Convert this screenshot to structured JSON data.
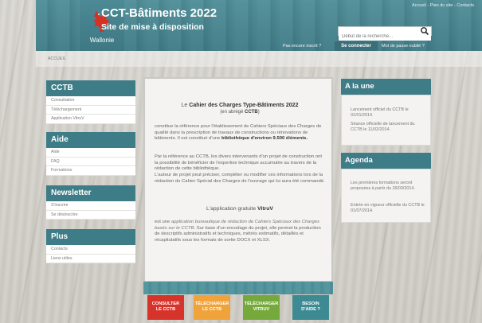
{
  "header": {
    "logo_text": "Wallonie",
    "title": "CCT-Bâtiments 2022",
    "subtitle": "Site de mise à disposition",
    "top_links": "Accueil - Plan du site - Contacts",
    "search_placeholder": "Début de la recherche...",
    "signup_text": "Pas encore inscrit ?",
    "login_label": "Se connecter",
    "forgot_label": "Mot de passe oublié ?"
  },
  "breadcrumb": "ACCUEIL",
  "left_sidebar": {
    "cctb": {
      "title": "CCTB",
      "items": [
        "Consultation",
        "Téléchargement",
        "Application VitruV"
      ]
    },
    "aide": {
      "title": "Aide",
      "items": [
        "Aide",
        "FAQ",
        "Formations"
      ]
    },
    "newsletter": {
      "title": "Newsletter",
      "items": [
        "S'inscrire",
        "Se désinscrire"
      ]
    },
    "plus": {
      "title": "Plus",
      "items": [
        "Contacts",
        "Liens utiles"
      ]
    }
  },
  "content": {
    "title_prefix": "Le ",
    "title_bold": "Cahier des Charges Type-Bâtiments 2022",
    "subtitle_prefix": "(en abrégé ",
    "subtitle_bold": "CCTB",
    "subtitle_suffix": ")",
    "para1_text": "constitue la référence pour l'établissement de Cahiers Spéciaux des Charges de qualité dans la prescription de travaux de constructions ou rénovations de bâtiments.  Il est constitué d'une ",
    "para1_bold": "bibliothèque d'environ 9.500 éléments.",
    "para2": "Par la référence au CCTB, les divers intervenants d'un projet de construction ont la possibilité de bénéficier de l'expertise technique accumulée au travers de la rédaction de cette bibliothèque.",
    "para3": "L'auteur de projet peut préciser, compléter ou modifier ces informations lors de la rédaction du Cahier Spécial des Charges de l'ouvrage qui lui aura été commandé.",
    "app_prefix": "L'application gratuite ",
    "app_bold": "VitruV",
    "para4_prefix": "est une ",
    "para4_italic": "application bureautique de rédaction de Cahiers Spéciaux des Charges basés sur le CCTB",
    "para4_suffix": ".  Sur base d'un encodage du projet, elle permet la production de descriptifs administratifs et techniques, métrés estimatifs, détaillés et récapitulatifs sous les formats de sortie DOCX et XLSX."
  },
  "actions": [
    {
      "line1": "CONSULTER",
      "line2": "LE CCTB",
      "color": "#d6332b"
    },
    {
      "line1": "TÉLÉCHARGER",
      "line2": "LE CCTB",
      "color": "#f0a23b"
    },
    {
      "line1": "TÉLÉCHARGER",
      "line2": "VITRUV",
      "color": "#76a93c"
    },
    {
      "line1": "BESOIN",
      "line2": "D'AIDE ?",
      "color": "#3d8a93"
    }
  ],
  "right_sidebar": {
    "une": {
      "title": "A la une",
      "items": [
        "Lancement officiel du CCTB le 01/01/2014.",
        "Séance officielle de lancement du CCTB le 11/02/2014."
      ]
    },
    "agenda": {
      "title": "Agenda",
      "items": [
        "Les premières formations seront proposées à partir du 26/03/2014.",
        "Entrée en vigueur officielle du CCTB le 01/07/2014."
      ]
    }
  },
  "colors": {
    "teal": "#3e7c87",
    "red": "#d6332b",
    "orange": "#f0a23b",
    "green": "#76a93c"
  }
}
